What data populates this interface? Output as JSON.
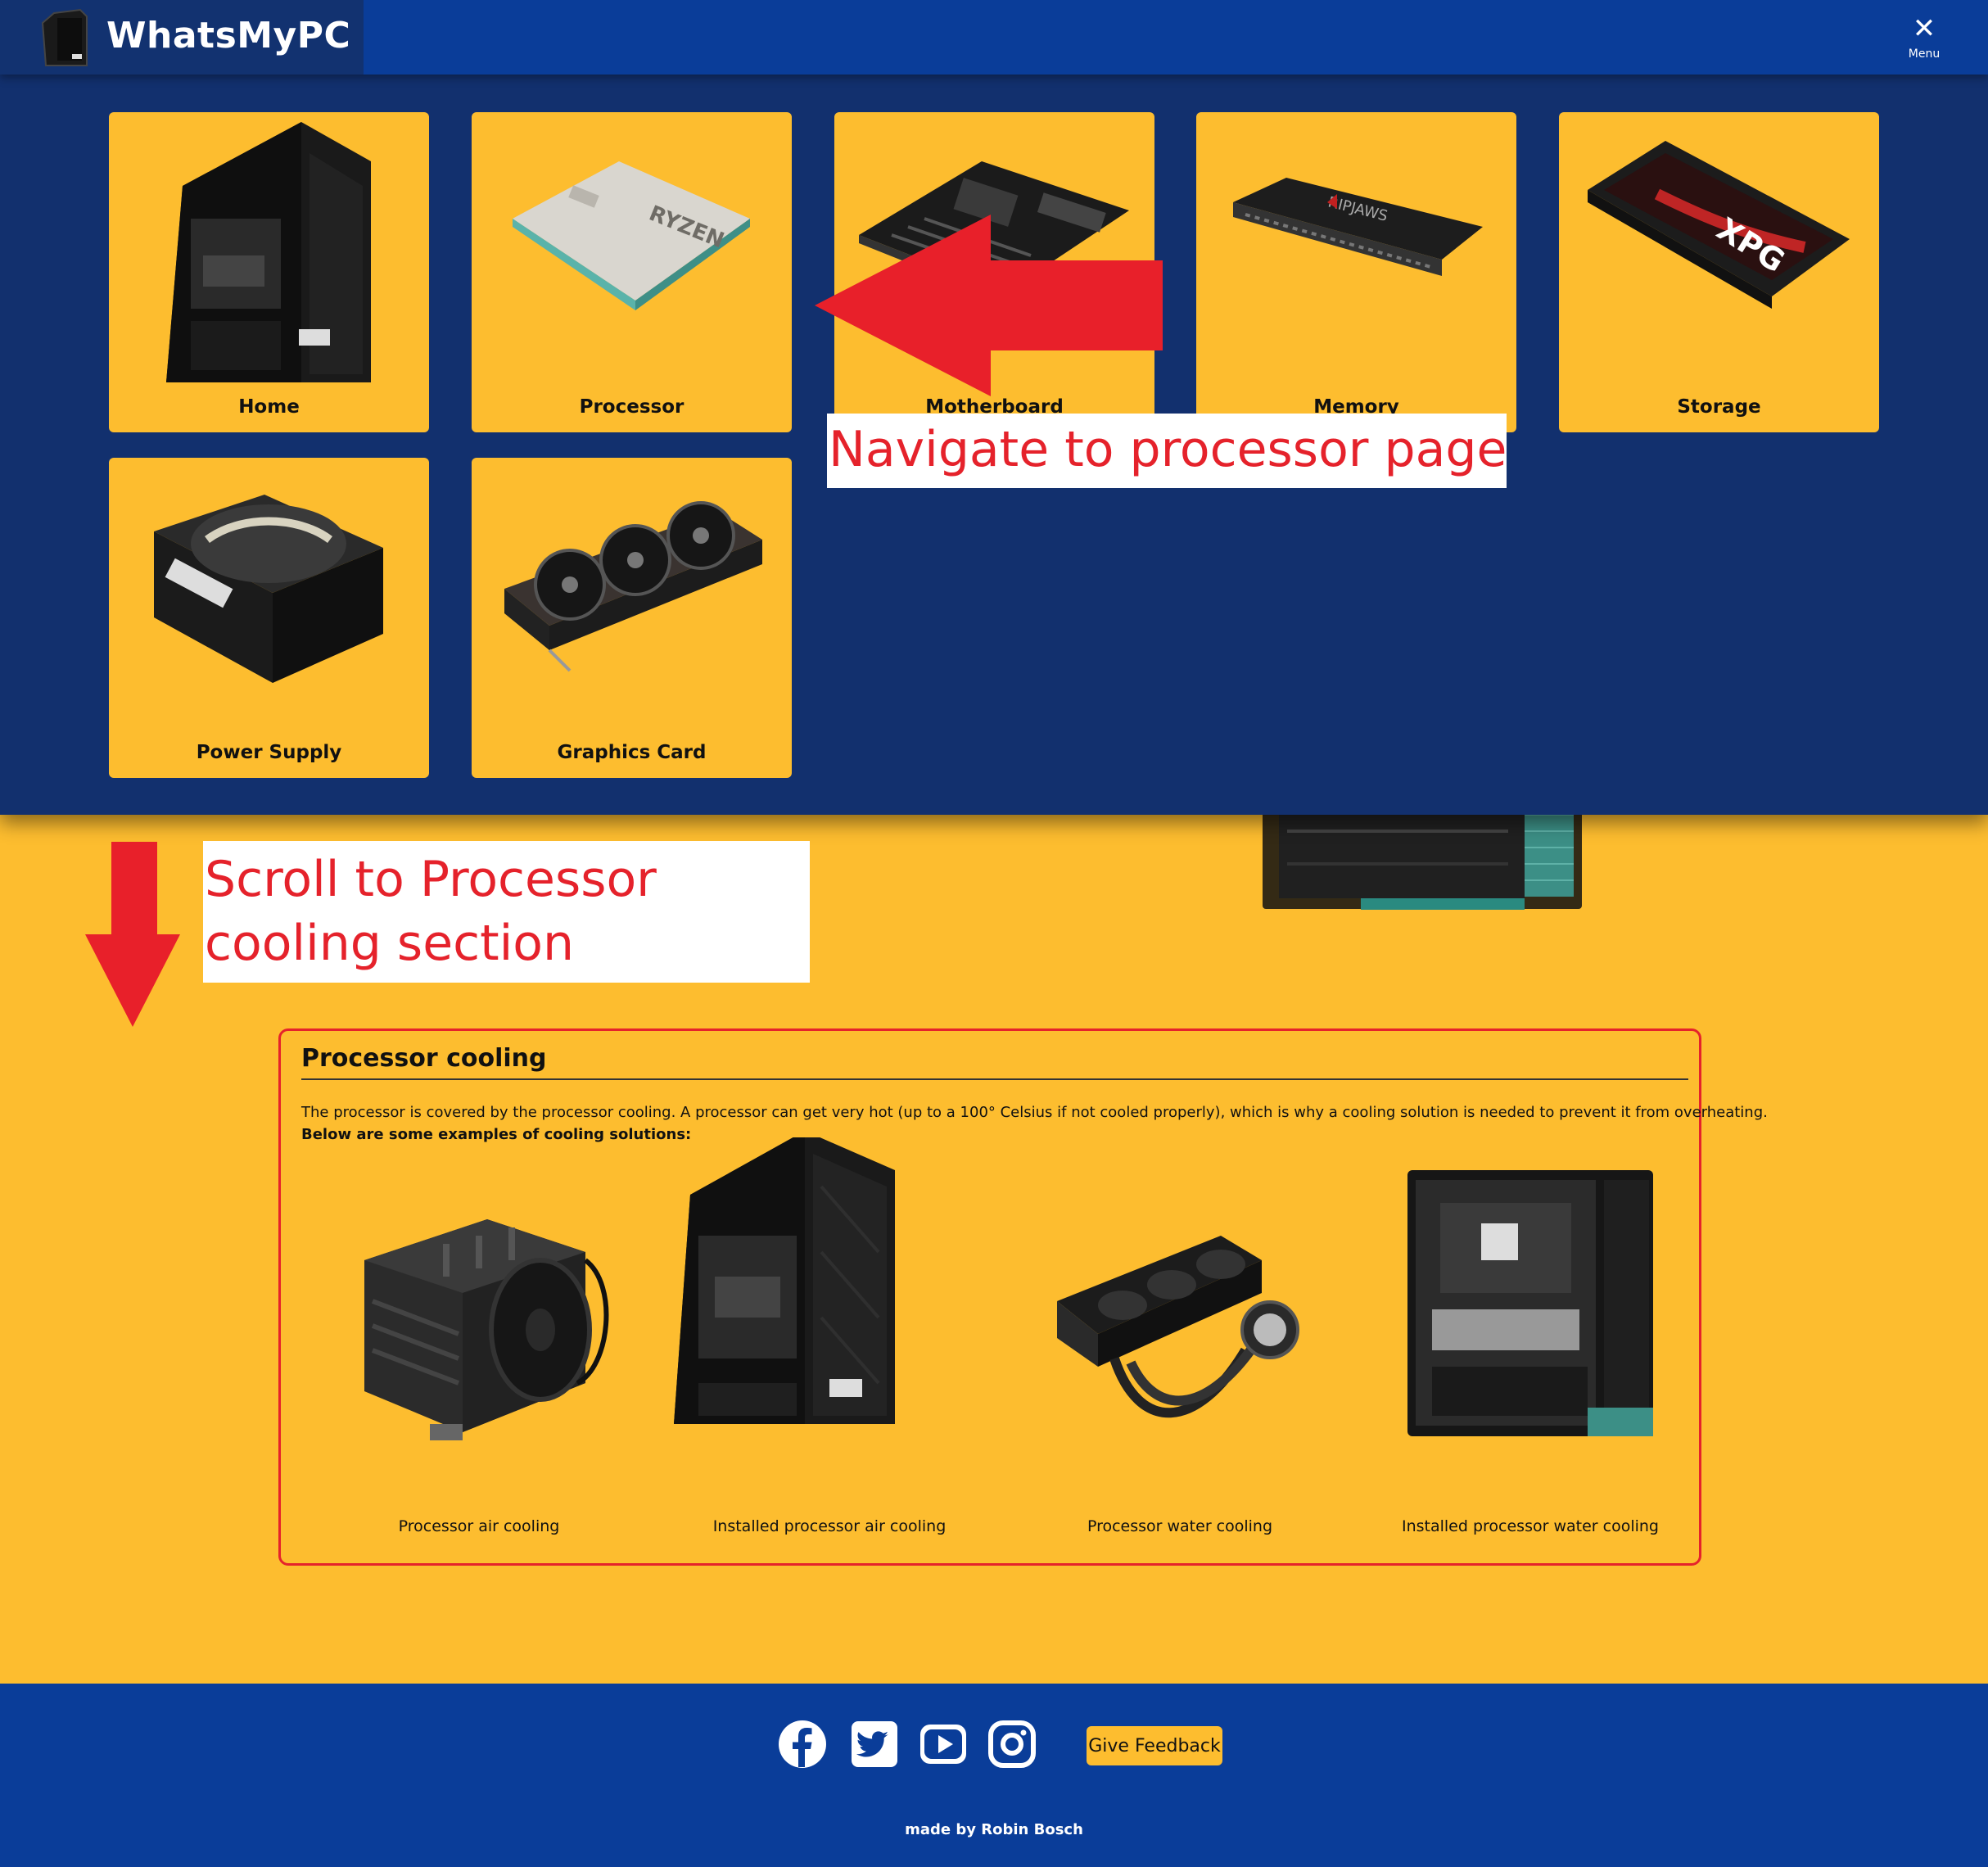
{
  "header": {
    "brand_title": "WhatsMyPC",
    "menu_icon": "close-icon",
    "menu_label": "Menu"
  },
  "nav_menu": {
    "items": [
      {
        "label": "Home",
        "icon": "pc-case-icon"
      },
      {
        "label": "Processor",
        "icon": "cpu-icon"
      },
      {
        "label": "Motherboard",
        "icon": "motherboard-icon"
      },
      {
        "label": "Memory",
        "icon": "ram-icon"
      },
      {
        "label": "Storage",
        "icon": "ssd-icon"
      },
      {
        "label": "Power Supply",
        "icon": "psu-icon"
      },
      {
        "label": "Graphics Card",
        "icon": "gpu-icon"
      }
    ]
  },
  "section": {
    "title": "Processor cooling",
    "body": "The processor is covered by the processor cooling. A processor can get very hot (up to a 100° Celsius if not cooled properly), which is why a cooling solution is needed to prevent it from overheating.",
    "intro": "Below are some examples of cooling solutions:",
    "examples": [
      {
        "caption": "Processor air cooling"
      },
      {
        "caption": "Installed processor air cooling"
      },
      {
        "caption": "Processor water cooling"
      },
      {
        "caption": "Installed processor water cooling"
      }
    ]
  },
  "footer": {
    "social": [
      "facebook-icon",
      "twitter-icon",
      "youtube-icon",
      "instagram-icon"
    ],
    "feedback_label": "Give Feedback",
    "credit": "made by Robin Bosch"
  },
  "annotations": {
    "navigate": "Navigate to processor page",
    "scroll_line1": "Scroll to Processor",
    "scroll_line2": "cooling section"
  },
  "colors": {
    "header_blue": "#0A3D99",
    "overlay_navy": "#12306E",
    "accent_yellow": "#FDBD2F",
    "annotation_red": "#E5222B"
  }
}
